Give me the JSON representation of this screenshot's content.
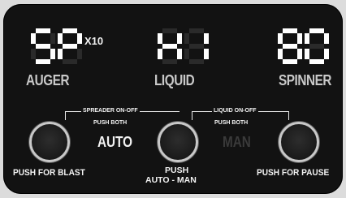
{
  "displays": {
    "auger": {
      "value": "5P",
      "multiplier": "X10",
      "label": "AUGER"
    },
    "liquid": {
      "value": "H1",
      "label": "LIQUID"
    },
    "spinner": {
      "value": "80",
      "label": "SPINNER"
    }
  },
  "controls": {
    "spreader_label": "SPREADER ON-OFF",
    "spreader_sub": "PUSH BOTH",
    "liquid_label": "LIQUID ON-OFF",
    "liquid_sub": "PUSH BOTH",
    "mode_auto": "AUTO",
    "mode_man": "MAN",
    "blast_label": "PUSH FOR BLAST",
    "mode_label_line1": "PUSH",
    "mode_label_line2": "AUTO - MAN",
    "pause_label": "PUSH FOR PAUSE"
  },
  "colors": {
    "panel": "#121212",
    "segment_on": "#ffffff",
    "segment_off": "#2a2a2a",
    "mode_active": "#f2f2f2",
    "mode_inactive": "#3a3a3a"
  }
}
